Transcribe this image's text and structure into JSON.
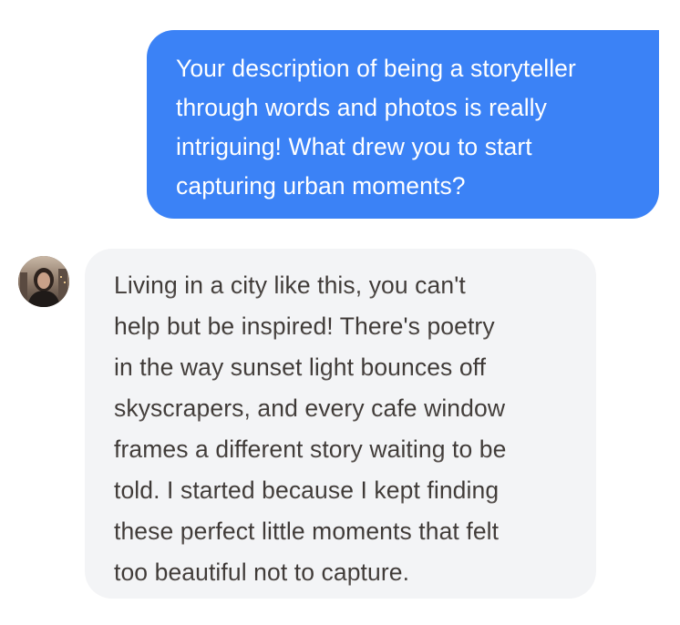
{
  "conversation": {
    "user_message": {
      "lines": [
        "Your description of being a storyteller",
        "through words and photos is really",
        "intriguing! What drew you to start",
        "capturing urban moments?"
      ]
    },
    "ai_message": {
      "avatar_icon": "person-avatar-icon",
      "lines": [
        "Living in a city like this, you can't",
        "help but be inspired! There's poetry",
        "in the way sunset light bounces off",
        "skyscrapers, and every cafe window",
        "frames a different story waiting to be",
        "told. I started because I kept finding",
        "these perfect little moments that felt",
        "too beautiful not to capture."
      ]
    }
  },
  "colors": {
    "user_bubble": "#3b82f6",
    "ai_bubble": "#f3f4f6",
    "ai_text": "#3f3a37"
  }
}
